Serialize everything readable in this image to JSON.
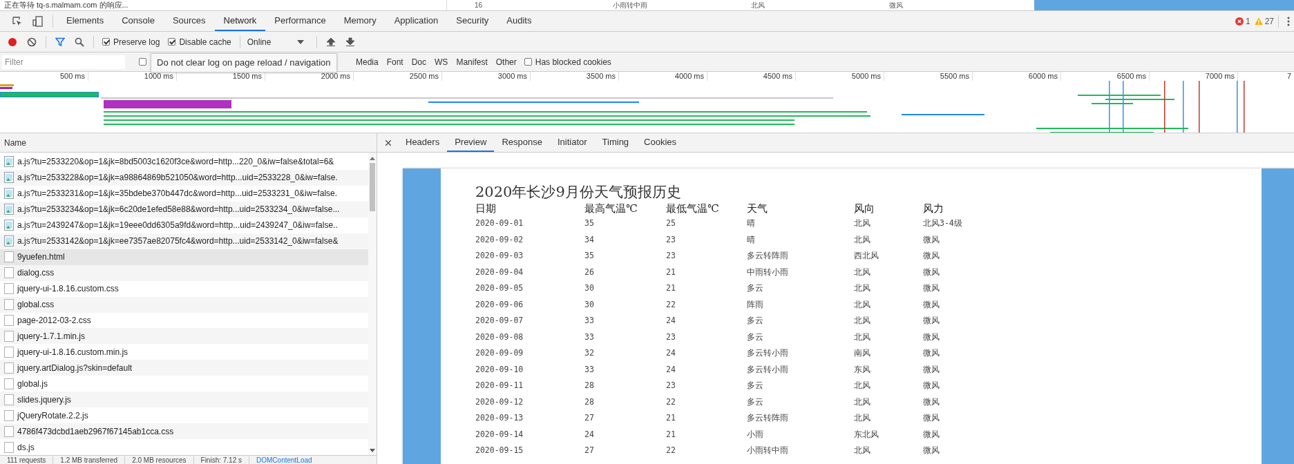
{
  "page_behind": {
    "status": "正在等待 tq-s.malmam.com 的响应...",
    "row_fragment": [
      "16",
      "小雨转中雨",
      "北风",
      "微风"
    ]
  },
  "panel_tabs": [
    {
      "label": "Elements",
      "selected": false
    },
    {
      "label": "Console",
      "selected": false
    },
    {
      "label": "Sources",
      "selected": false
    },
    {
      "label": "Network",
      "selected": true
    },
    {
      "label": "Performance",
      "selected": false
    },
    {
      "label": "Memory",
      "selected": false
    },
    {
      "label": "Application",
      "selected": false
    },
    {
      "label": "Security",
      "selected": false
    },
    {
      "label": "Audits",
      "selected": false
    }
  ],
  "counts": {
    "errors": "1",
    "warnings": "27"
  },
  "toolbar": {
    "recording": true,
    "preserve_log": {
      "label": "Preserve log",
      "checked": true
    },
    "disable_cache": {
      "label": "Disable cache",
      "checked": true
    },
    "throttling": "Online"
  },
  "filter_bar": {
    "placeholder": "Filter",
    "hide_data_urls": {
      "checked": false
    },
    "types": [
      "Media",
      "Font",
      "Doc",
      "WS",
      "Manifest",
      "Other"
    ],
    "blocked_cookies": {
      "label": "Has blocked cookies",
      "checked": false
    }
  },
  "tooltip": "Do not clear log on page reload / navigation",
  "timeline": {
    "ticks": [
      "500 ms",
      "1000 ms",
      "1500 ms",
      "2000 ms",
      "2500 ms",
      "3000 ms",
      "3500 ms",
      "4000 ms",
      "4500 ms",
      "5000 ms",
      "5500 ms",
      "6000 ms",
      "6500 ms",
      "7000 ms",
      "7"
    ]
  },
  "requests": {
    "header": "Name",
    "rows": [
      {
        "name": "a.js?tu=2533220&op=1&jk=8bd5003c1620f3ce&word=http...220_0&iw=false&total=6&",
        "kind": "image",
        "selected": false
      },
      {
        "name": "a.js?tu=2533228&op=1&jk=a98864869b521050&word=http...uid=2533228_0&iw=false.",
        "kind": "image",
        "selected": false
      },
      {
        "name": "a.js?tu=2533231&op=1&jk=35bdebe370b447dc&word=http...uid=2533231_0&iw=false.",
        "kind": "image",
        "selected": false
      },
      {
        "name": "a.js?tu=2533234&op=1&jk=6c20de1efed58e88&word=http...uid=2533234_0&iw=false...",
        "kind": "image",
        "selected": false
      },
      {
        "name": "a.js?tu=2439247&op=1&jk=19eee0dd6305a9fd&word=http...uid=2439247_0&iw=false..",
        "kind": "image",
        "selected": false
      },
      {
        "name": "a.js?tu=2533142&op=1&jk=ee7357ae82075fc4&word=http...uid=2533142_0&iw=false&",
        "kind": "image",
        "selected": false
      },
      {
        "name": "9yuefen.html",
        "kind": "file",
        "selected": true
      },
      {
        "name": "dialog.css",
        "kind": "file",
        "selected": false
      },
      {
        "name": "jquery-ui-1.8.16.custom.css",
        "kind": "file",
        "selected": false
      },
      {
        "name": "global.css",
        "kind": "file",
        "selected": false
      },
      {
        "name": "page-2012-03-2.css",
        "kind": "file",
        "selected": false
      },
      {
        "name": "jquery-1.7.1.min.js",
        "kind": "file",
        "selected": false
      },
      {
        "name": "jquery-ui-1.8.16.custom.min.js",
        "kind": "file",
        "selected": false
      },
      {
        "name": "jquery.artDialog.js?skin=default",
        "kind": "file",
        "selected": false
      },
      {
        "name": "global.js",
        "kind": "file",
        "selected": false
      },
      {
        "name": "slides.jquery.js",
        "kind": "file",
        "selected": false
      },
      {
        "name": "jQueryRotate.2.2.js",
        "kind": "file",
        "selected": false
      },
      {
        "name": "4786f473dcbd1aeb2967f67145ab1cca.css",
        "kind": "file",
        "selected": false
      },
      {
        "name": "ds.js",
        "kind": "file",
        "selected": false
      }
    ]
  },
  "status_bar": [
    "111 requests",
    "1.2 MB transferred",
    "2.0 MB resources",
    "Finish: 7.12 s",
    "DOMContentLoad"
  ],
  "detail_tabs": [
    {
      "label": "Headers",
      "selected": false
    },
    {
      "label": "Preview",
      "selected": true
    },
    {
      "label": "Response",
      "selected": false
    },
    {
      "label": "Initiator",
      "selected": false
    },
    {
      "label": "Timing",
      "selected": false
    },
    {
      "label": "Cookies",
      "selected": false
    }
  ],
  "preview": {
    "title": "2020年长沙9月份天气预报历史",
    "columns": [
      "日期",
      "最高气温℃",
      "最低气温℃",
      "天气",
      "风向",
      "风力"
    ],
    "rows": [
      [
        "2020-09-01",
        "35",
        "25",
        "晴",
        "北风",
        "北风3-4级"
      ],
      [
        "2020-09-02",
        "34",
        "23",
        "晴",
        "北风",
        "微风"
      ],
      [
        "2020-09-03",
        "35",
        "23",
        "多云转阵雨",
        "西北风",
        "微风"
      ],
      [
        "2020-09-04",
        "26",
        "21",
        "中雨转小雨",
        "北风",
        "微风"
      ],
      [
        "2020-09-05",
        "30",
        "21",
        "多云",
        "北风",
        "微风"
      ],
      [
        "2020-09-06",
        "30",
        "22",
        "阵雨",
        "北风",
        "微风"
      ],
      [
        "2020-09-07",
        "33",
        "24",
        "多云",
        "北风",
        "微风"
      ],
      [
        "2020-09-08",
        "33",
        "23",
        "多云",
        "北风",
        "微风"
      ],
      [
        "2020-09-09",
        "32",
        "24",
        "多云转小雨",
        "南风",
        "微风"
      ],
      [
        "2020-09-10",
        "33",
        "24",
        "多云转小雨",
        "东风",
        "微风"
      ],
      [
        "2020-09-11",
        "28",
        "23",
        "多云",
        "北风",
        "微风"
      ],
      [
        "2020-09-12",
        "28",
        "22",
        "多云",
        "北风",
        "微风"
      ],
      [
        "2020-09-13",
        "27",
        "21",
        "多云转阵雨",
        "北风",
        "微风"
      ],
      [
        "2020-09-14",
        "24",
        "21",
        "小雨",
        "东北风",
        "微风"
      ],
      [
        "2020-09-15",
        "27",
        "22",
        "小雨转中雨",
        "北风",
        "微风"
      ]
    ]
  }
}
